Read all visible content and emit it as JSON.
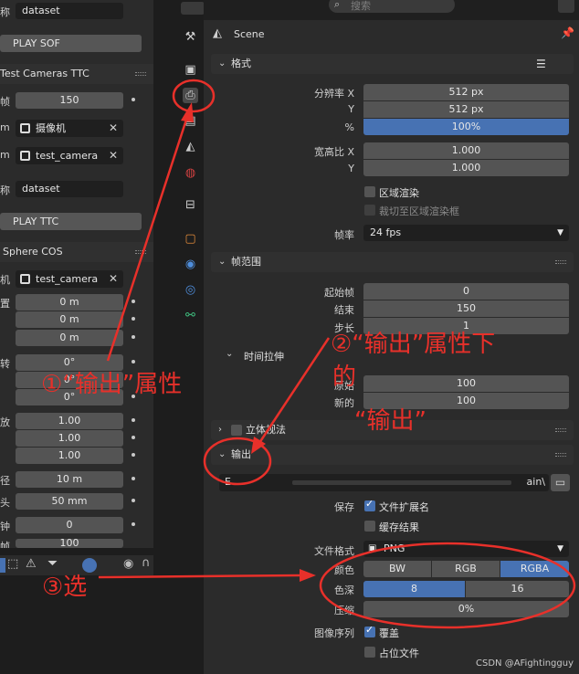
{
  "left_panel": {
    "name_label_1": "称",
    "name_value_1": "dataset",
    "play_sof": "PLAY SOF",
    "section_ttc": "Test Cameras TTC",
    "frame_label": "帧",
    "frame_value": "150",
    "cam_label_1": "m",
    "cam_value_1": "摄像机",
    "cam_label_2": "m",
    "cam_value_2": "test_camera",
    "name_label_2": "称",
    "name_value_2": "dataset",
    "play_ttc": "PLAY TTC",
    "section_cos": "Sphere COS",
    "machine_label": "机",
    "machine_value": "test_camera",
    "pos_label": "置",
    "loc_values": [
      "0 m",
      "0 m",
      "0 m"
    ],
    "rot_label": "转",
    "rot_values": [
      "0°",
      "0°",
      "0°"
    ],
    "scale_label": "放",
    "scale_values": [
      "1.00",
      "1.00",
      "1.00"
    ],
    "radius_label": "径",
    "radius_value": "10 m",
    "lens_label": "头",
    "lens_value": "50 mm",
    "extra_label_1": "钟",
    "extra_value_1": "0",
    "extra_label_2": "帧",
    "extra_value_2": "100"
  },
  "topbar": {
    "search_placeholder": "搜索"
  },
  "properties": {
    "scene_title": "Scene",
    "format_section": "格式",
    "res_x_label": "分辨率 X",
    "res_x_value": "512 px",
    "res_y_label": "Y",
    "res_y_value": "512 px",
    "res_pct_label": "%",
    "res_pct_value": "100%",
    "aspect_x_label": "宽高比 X",
    "aspect_x_value": "1.000",
    "aspect_y_label": "Y",
    "aspect_y_value": "1.000",
    "region_render": "区域渲染",
    "crop_region": "裁切至区域渲染框",
    "fps_label": "帧率",
    "fps_value": "24 fps",
    "frame_range_section": "帧范围",
    "start_label": "起始帧",
    "start_value": "0",
    "end_label": "结束",
    "end_value": "150",
    "step_label": "步长",
    "step_value": "1",
    "time_stretch_section": "时间拉伸",
    "old_label": "原始",
    "old_value": "100",
    "new_label": "新的",
    "new_value": "100",
    "stereo_section": "立体视法",
    "output_section": "输出",
    "output_path_tail": "ain\\",
    "save_label": "保存",
    "file_ext": "文件扩展名",
    "cache_result": "缓存结果",
    "file_format_label": "文件格式",
    "file_format_value": "PNG",
    "color_label": "颜色",
    "color_options": [
      "BW",
      "RGB",
      "RGBA"
    ],
    "depth_label": "色深",
    "depth_options": [
      "8",
      "16"
    ],
    "compression_label": "压缩",
    "compression_value": "0%",
    "image_seq_label": "图像序列",
    "overwrite": "覆盖",
    "placeholder_file": "占位文件"
  },
  "annotations": {
    "a1": "①“输出”属性",
    "a2_line1": "②“输出”属性下",
    "a2_line2": "的",
    "a2_line3": "“输出”",
    "a3": "③选"
  },
  "watermark": "CSDN @AFightingguy",
  "colors": {
    "accent_blue": "#4772b3",
    "annotation_red": "#e8302a",
    "panel_bg": "#2b2b2b"
  }
}
